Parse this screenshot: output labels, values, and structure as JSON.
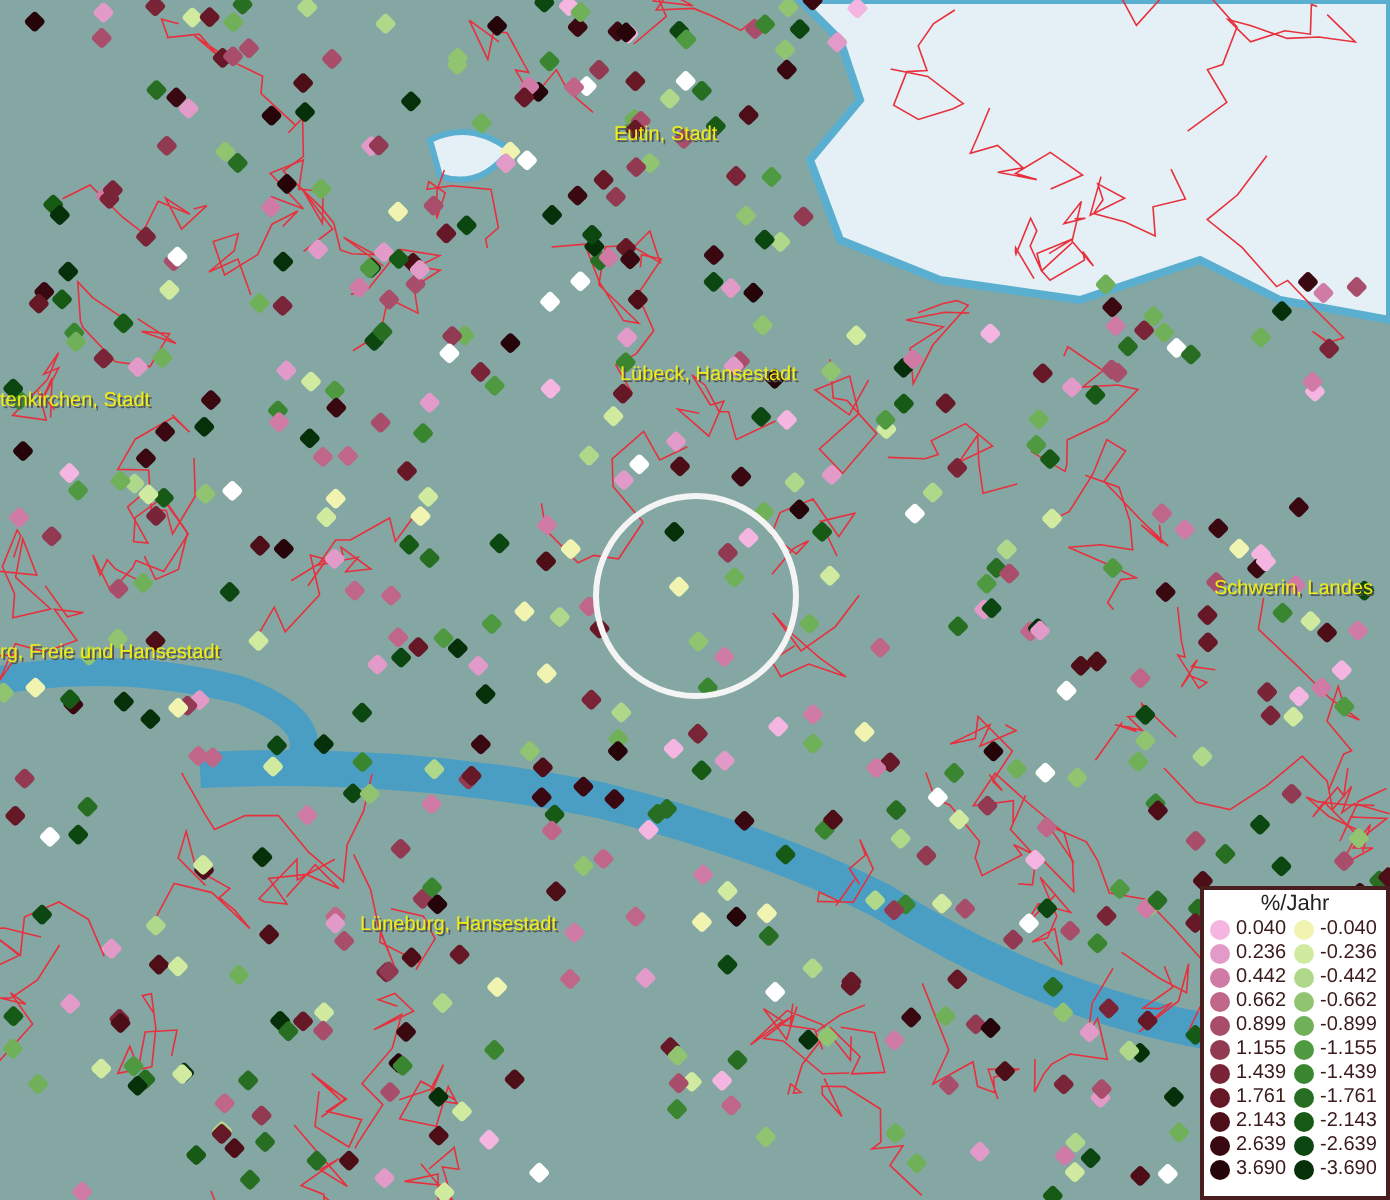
{
  "map_labels": [
    {
      "text": "Eutin, Stadt"
    },
    {
      "text": "Lübeck, Hansestadt"
    },
    {
      "text": "tenkirchen, Stadt"
    },
    {
      "text": "rg, Freie und Hansestadt"
    },
    {
      "text": "Lüneburg, Hansestadt"
    },
    {
      "text": "Schwerin, Landes"
    }
  ],
  "legend": {
    "title": "%/Jahr",
    "increase": [
      {
        "value": "0.040",
        "color": "#f4b6e0"
      },
      {
        "value": "0.236",
        "color": "#e29ac9"
      },
      {
        "value": "0.442",
        "color": "#d07aa6"
      },
      {
        "value": "0.662",
        "color": "#c06688"
      },
      {
        "value": "0.899",
        "color": "#a84d6a"
      },
      {
        "value": "1.155",
        "color": "#913a52"
      },
      {
        "value": "1.439",
        "color": "#7a2438"
      },
      {
        "value": "1.761",
        "color": "#661827"
      },
      {
        "value": "2.143",
        "color": "#4e0e18"
      },
      {
        "value": "2.639",
        "color": "#3a0810"
      },
      {
        "value": "3.690",
        "color": "#25040a"
      }
    ],
    "decrease": [
      {
        "value": "-0.040",
        "color": "#f0f4b0"
      },
      {
        "value": "-0.236",
        "color": "#d0eaa0"
      },
      {
        "value": "-0.442",
        "color": "#b0d88a"
      },
      {
        "value": "-0.662",
        "color": "#90c470"
      },
      {
        "value": "-0.899",
        "color": "#70b058"
      },
      {
        "value": "-1.155",
        "color": "#4f9a40"
      },
      {
        "value": "-1.439",
        "color": "#3a8530"
      },
      {
        "value": "-1.761",
        "color": "#276e22"
      },
      {
        "value": "-2.143",
        "color": "#175a16"
      },
      {
        "value": "-2.639",
        "color": "#0c4610"
      },
      {
        "value": "-3.690",
        "color": "#06300a"
      }
    ]
  }
}
